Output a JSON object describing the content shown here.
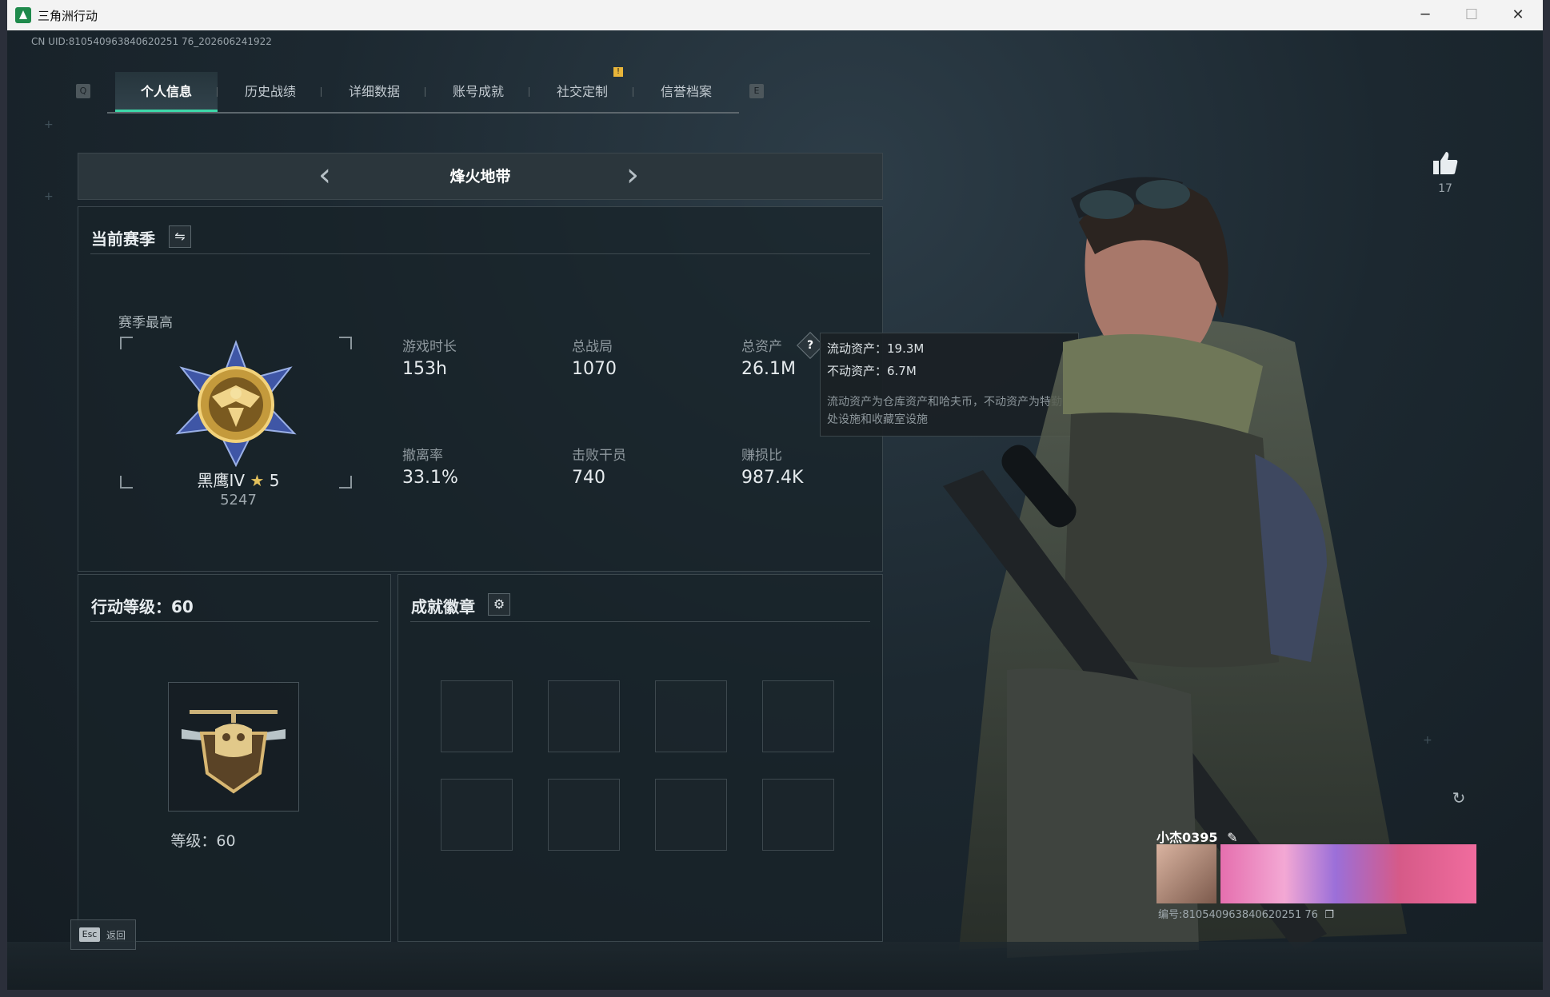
{
  "window": {
    "title": "三角洲行动",
    "minimize": "─",
    "maximize": "☐",
    "close": "✕"
  },
  "uid_text": "CN UID:810540963840620251 76_202606241922",
  "tabs": {
    "prev_key": "Q",
    "next_key": "E",
    "items": [
      "个人信息",
      "历史战绩",
      "详细数据",
      "账号成就",
      "社交定制",
      "信誉档案"
    ],
    "active_index": 0,
    "notice_mark": "!"
  },
  "mode": {
    "title": "烽火地带",
    "prev_icon": "‹",
    "next_icon": "›"
  },
  "season": {
    "title": "当前赛季",
    "switch_icon": "⇋",
    "best_label": "赛季最高",
    "rank_name": "黑鹰IV",
    "rank_star": "★",
    "rank_stars_count": "5",
    "rank_score": "5247",
    "stats": [
      {
        "label": "游戏时长",
        "value": "153h"
      },
      {
        "label": "总战局",
        "value": "1070"
      },
      {
        "label": "总资产",
        "value": "26.1M"
      },
      {
        "label": "撤离率",
        "value": "33.1%"
      },
      {
        "label": "击败干员",
        "value": "740"
      },
      {
        "label": "赚损比",
        "value": "987.4K"
      }
    ],
    "asset_help_icon": "?"
  },
  "tooltip": {
    "liquid": "流动资产：19.3M",
    "fixed": "不动资产：6.7M",
    "desc": "流动资产为仓库资产和哈夫币，不动资产为特勤处设施和收藏室设施"
  },
  "level_panel": {
    "title": "行动等级：60",
    "level_text": "等级：60"
  },
  "badges_panel": {
    "title": "成就徽章",
    "settings_icon": "⚙",
    "slots": 8
  },
  "likes": {
    "count": "17"
  },
  "player": {
    "name": "小杰0395",
    "edit_icon": "✎",
    "id_text": "编号:810540963840620251 76",
    "copy_icon": "❐"
  },
  "refresh_icon": "↻",
  "esc": {
    "key": "Esc",
    "label": "返回"
  },
  "colors": {
    "accent": "#3ed7a9",
    "notice": "#e8b53a"
  }
}
